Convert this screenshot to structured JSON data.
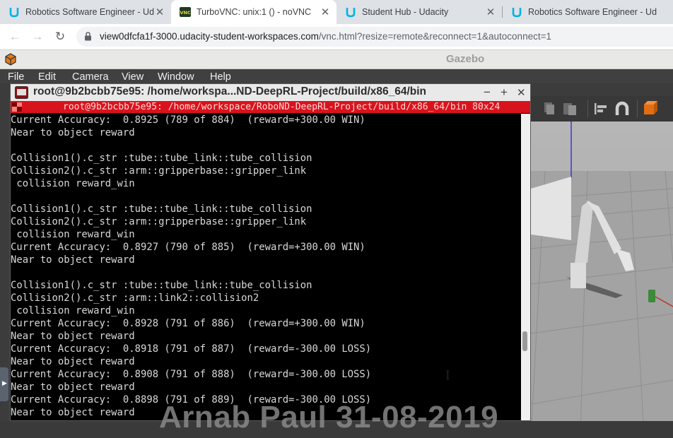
{
  "browser": {
    "tabs": [
      {
        "title": "Robotics Software Engineer - Ud",
        "icon": "udacity-icon",
        "active": false
      },
      {
        "title": "TurboVNC: unix:1 () - noVNC",
        "icon": "vnc-icon",
        "active": true
      },
      {
        "title": "Student Hub - Udacity",
        "icon": "udacity-icon",
        "active": false
      },
      {
        "title": "Robotics Software Engineer - Ud",
        "icon": "udacity-icon",
        "active": false
      }
    ],
    "close_glyph": "✕",
    "url_host": "view0dfcfa1f-3000.udacity-student-workspaces.com",
    "url_path": "/vnc.html?resize=remote&reconnect=1&autoconnect=1"
  },
  "gazebo": {
    "title": "Gazebo",
    "menu": [
      "File",
      "Edit",
      "Camera",
      "View",
      "Window",
      "Help"
    ]
  },
  "terminal": {
    "window_title": "root@9b2bcbb75e95: /home/workspa...ND-DeepRL-Project/build/x86_64/bin",
    "tab_title": "root@9b2bcbb75e95: /home/workspace/RoboND-DeepRL-Project/build/x86_64/bin 80x24",
    "controls": [
      "−",
      "+",
      "✕"
    ],
    "lines": [
      "Current Accuracy:  0.8925 (789 of 884)  (reward=+300.00 WIN)",
      "Near to object reward",
      "",
      "Collision1().c_str :tube::tube_link::tube_collision",
      "Collision2().c_str :arm::gripperbase::gripper_link",
      " collision reward_win",
      "",
      "Collision1().c_str :tube::tube_link::tube_collision",
      "Collision2().c_str :arm::gripperbase::gripper_link",
      " collision reward_win",
      "Current Accuracy:  0.8927 (790 of 885)  (reward=+300.00 WIN)",
      "Near to object reward",
      "",
      "Collision1().c_str :tube::tube_link::tube_collision",
      "Collision2().c_str :arm::link2::collision2",
      " collision reward_win",
      "Current Accuracy:  0.8928 (791 of 886)  (reward=+300.00 WIN)",
      "Near to object reward",
      "Current Accuracy:  0.8918 (791 of 887)  (reward=-300.00 LOSS)",
      "Near to object reward",
      "Current Accuracy:  0.8908 (791 of 888)  (reward=-300.00 LOSS)",
      "Near to object reward",
      "Current Accuracy:  0.8898 (791 of 889)  (reward=-300.00 LOSS)",
      "Near to object reward"
    ]
  },
  "watermark": "Arnab Paul 31-08-2019",
  "colors": {
    "terminal_tab": "#d8131c",
    "gazebo_menu": "#404040",
    "udacity": "#02b3e4"
  }
}
